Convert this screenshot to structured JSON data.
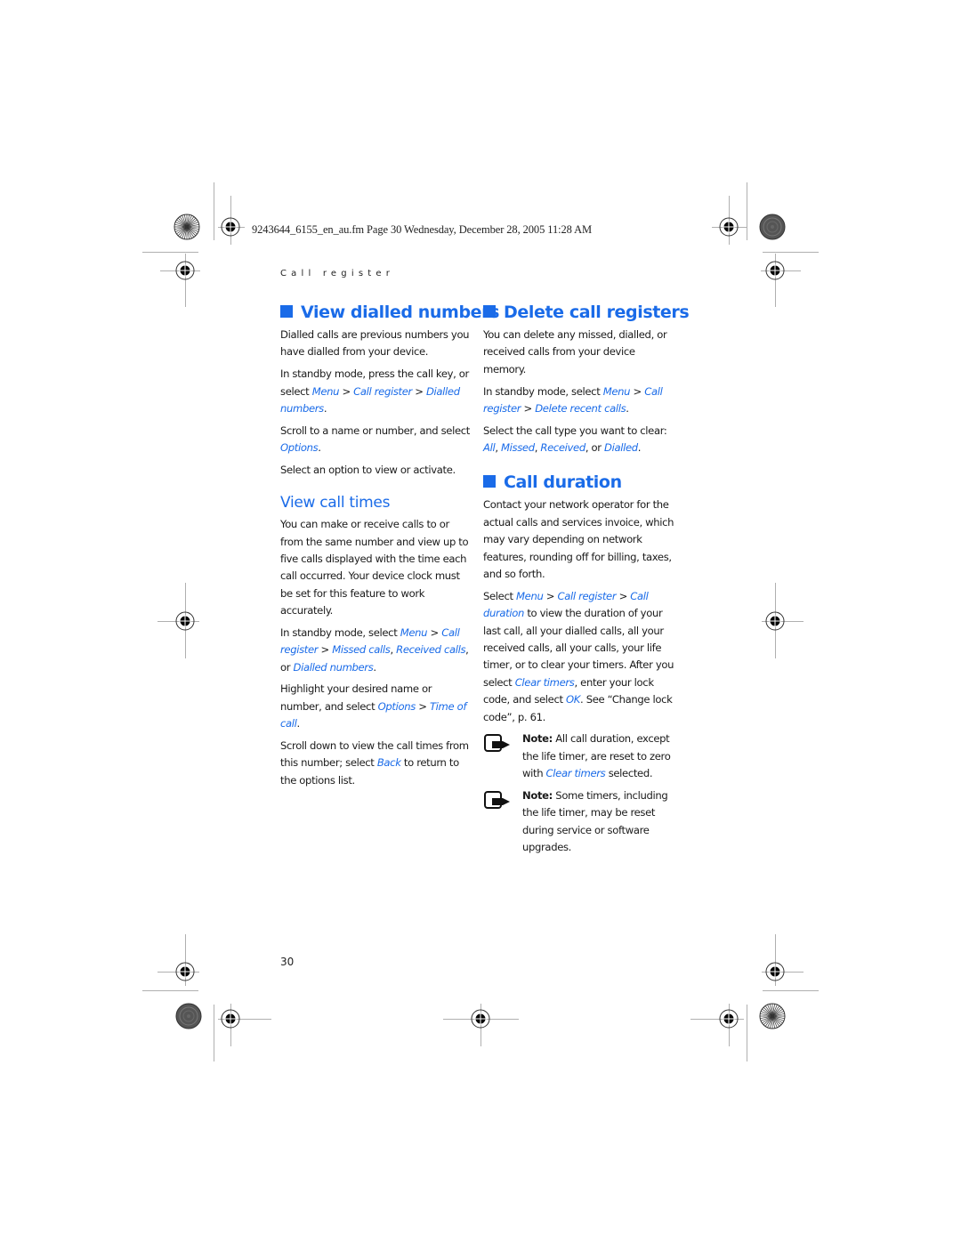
{
  "header": {
    "file_meta": "9243644_6155_en_au.fm  Page 30  Wednesday, December 28, 2005  11:28 AM",
    "section_label": "Call register"
  },
  "colors": {
    "accent": "#1a6be8",
    "text": "#1a1a1a"
  },
  "left_column": {
    "view_dialled": {
      "title": "View dialled numbers",
      "p1": "Dialled calls are previous numbers you have dialled from your device.",
      "p2_text1": "In standby mode, press the call key, or select ",
      "p2_link1": "Menu",
      "sep": " > ",
      "p2_link2": "Call register",
      "p2_link3": "Dialled numbers",
      "period": ".",
      "p3_text": "Scroll to a name or number, and select ",
      "p3_link": "Options",
      "p4": "Select an option to view or activate."
    },
    "view_call_times": {
      "title": "View call times",
      "p1": "You can make or receive calls to or from the same number and view up to five calls displayed with the time each call occurred. Your device clock must be set for this feature to work accurately.",
      "p2_text1": "In standby mode, select ",
      "p2_link1": "Menu",
      "p2_link2": "Call register",
      "p2_link3": "Missed calls",
      "comma": ", ",
      "p2_link4": "Received calls",
      "p2_or": ", or ",
      "p2_link5": "Dialled numbers",
      "p3_text": "Highlight your desired name or number, and select ",
      "p3_link1": "Options",
      "p3_link2": "Time of call",
      "p4_text1": "Scroll down to view the call times from this number; select ",
      "p4_link": "Back",
      "p4_text2": " to return to the options list."
    }
  },
  "right_column": {
    "delete_registers": {
      "title": "Delete call registers",
      "p1": "You can delete any missed, dialled, or received calls from your device memory.",
      "p2_text1": "In standby mode, select ",
      "p2_link1": "Menu",
      "p2_link2": "Call register",
      "p2_link3": "Delete recent calls",
      "p3_text": "Select the call type you want to clear: ",
      "p3_link1": "All",
      "p3_link2": "Missed",
      "p3_link3": "Received",
      "p3_or": ", or ",
      "p3_link4": "Dialled"
    },
    "call_duration": {
      "title": "Call duration",
      "p1": "Contact your network operator for the actual calls and services invoice, which may vary depending on network features, rounding off for billing, taxes, and so forth.",
      "p2_text1": "Select ",
      "p2_link1": "Menu",
      "p2_link2": "Call register",
      "p2_link3": "Call duration",
      "p2_text2": " to view the duration of your last call, all your dialled calls, all your received calls, all your calls, your life timer, or to clear your timers. After you select ",
      "p2_link4": "Clear timers",
      "p2_text3": ", enter your lock code, and select ",
      "p2_link5": "OK",
      "p2_text4": ". See “Change lock code”, p. 61.",
      "note1_label": "Note:",
      "note1_text1": " All call duration, except the life timer, are reset to zero with ",
      "note1_link": "Clear timers",
      "note1_text2": " selected.",
      "note2_label": "Note:",
      "note2_text": " Some timers, including the life timer, may be reset during service or software upgrades."
    }
  },
  "footer": {
    "page_number": "30"
  }
}
